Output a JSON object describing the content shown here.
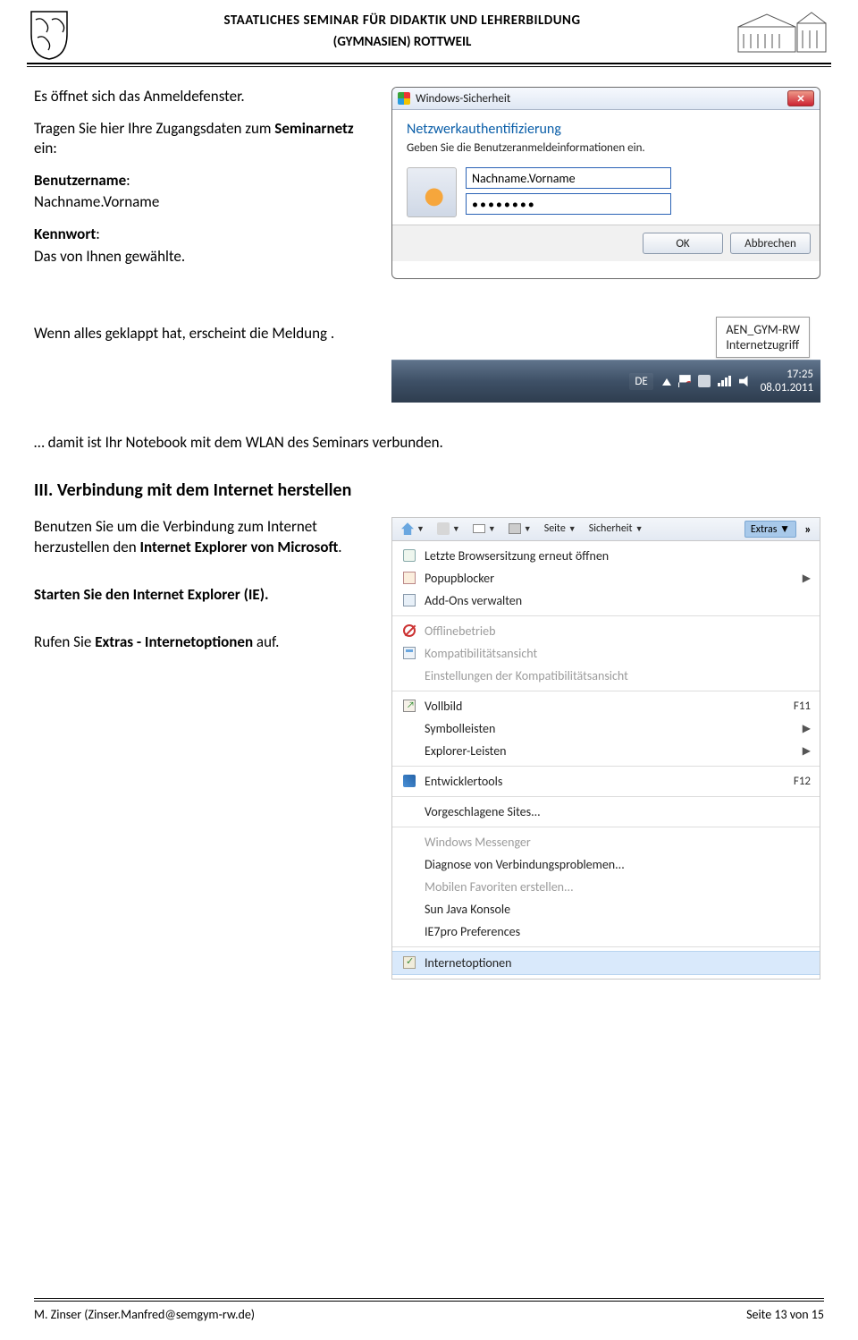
{
  "header": {
    "title1": "STAATLICHES SEMINAR FÜR DIDAKTIK UND LEHRERBILDUNG",
    "title2": "(GYMNASIEN) ROTTWEIL"
  },
  "intro": {
    "p1": "Es öffnet sich das Anmeldefenster.",
    "p2a": "Tragen Sie hier Ihre Zugangsdaten zum ",
    "p2b": "Seminarnetz",
    "p2c": " ein:",
    "p3a": "Benutzername",
    "p3b": ":",
    "p3c": "Nachname.Vorname",
    "p4a": "Kennwort",
    "p4b": ":",
    "p4c": "Das von Ihnen gewählte."
  },
  "winsec": {
    "title": "Windows-Sicherheit",
    "heading": "Netzwerkauthentifizierung",
    "sub": "Geben Sie die Benutzeranmeldeinformationen ein.",
    "username": "Nachname.Vorname",
    "password": "••••••••",
    "ok": "OK",
    "cancel": "Abbrechen"
  },
  "row2": {
    "text": "Wenn alles geklappt hat, erscheint die Meldung .",
    "tooltip_l1": "AEN_GYM-RW",
    "tooltip_l2": "Internetzugriff",
    "de": "DE",
    "time": "17:25",
    "date": "08.01.2011"
  },
  "connected": "… damit ist Ihr Notebook mit dem WLAN des Seminars verbunden.",
  "sec3": {
    "heading": "III. Verbindung mit dem Internet herstellen",
    "p1a": "Benutzen Sie um die Verbindung zum Internet herzustellen den ",
    "p1b": "Internet Explorer von Microsoft",
    "p1c": ".",
    "p2": "Starten Sie den Internet Explorer (IE).",
    "p3a": "Rufen Sie ",
    "p3b": "Extras - Internetoptionen",
    "p3c": " auf."
  },
  "ie": {
    "toolbar": {
      "seite": "Seite",
      "sicherheit": "Sicherheit",
      "extras": "Extras",
      "chev": "»"
    },
    "menu": [
      {
        "label": "Letzte Browsersitzung erneut öffnen",
        "icon": "hist",
        "disabled": false
      },
      {
        "label": "Popupblocker",
        "icon": "popup",
        "arrow": true
      },
      {
        "label": "Add-Ons verwalten",
        "icon": "addon"
      },
      {
        "sep": true
      },
      {
        "label": "Offlinebetrieb",
        "icon": "offline",
        "disabled": true
      },
      {
        "label": "Kompatibilitätsansicht",
        "icon": "compat",
        "disabled": true
      },
      {
        "label": "Einstellungen der Kompatibilitätsansicht",
        "icon": "",
        "disabled": true
      },
      {
        "sep": true
      },
      {
        "label": "Vollbild",
        "icon": "full",
        "shortcut": "F11"
      },
      {
        "label": "Symbolleisten",
        "icon": "",
        "arrow": true
      },
      {
        "label": "Explorer-Leisten",
        "icon": "",
        "arrow": true
      },
      {
        "sep": true
      },
      {
        "label": "Entwicklertools",
        "icon": "dev",
        "shortcut": "F12"
      },
      {
        "sep": true
      },
      {
        "label": "Vorgeschlagene Sites..."
      },
      {
        "sep": true
      },
      {
        "label": "Windows Messenger",
        "disabled": true
      },
      {
        "label": "Diagnose von Verbindungsproblemen..."
      },
      {
        "label": "Mobilen Favoriten erstellen...",
        "disabled": true
      },
      {
        "label": "Sun Java Konsole"
      },
      {
        "label": "IE7pro Preferences"
      },
      {
        "sep": true
      },
      {
        "label": "Internetoptionen",
        "icon": "opt",
        "selected": true
      }
    ]
  },
  "footer": {
    "left": "M. Zinser (Zinser.Manfred@semgym-rw.de)",
    "right": "Seite 13 von 15"
  }
}
